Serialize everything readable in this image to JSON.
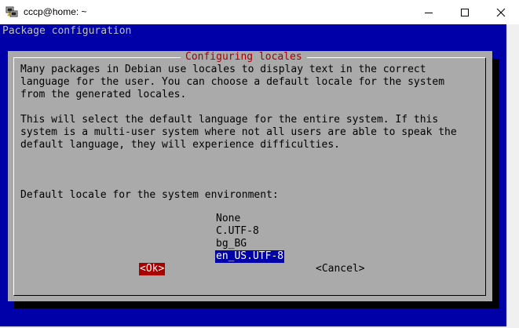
{
  "window": {
    "title": "cccp@home: ~"
  },
  "terminal": {
    "header": "Package configuration"
  },
  "dialog": {
    "title": "Configuring locales",
    "paragraph1": "Many packages in Debian use locales to display text in the correct\nlanguage for the user. You can choose a default locale for the system\nfrom the generated locales.",
    "paragraph2": "This will select the default language for the entire system. If this\nsystem is a multi-user system where not all users are able to speak the\ndefault language, they will experience difficulties.",
    "prompt": "Default locale for the system environment:",
    "options": [
      {
        "label": "None"
      },
      {
        "label": "C.UTF-8"
      },
      {
        "label": "bg_BG"
      },
      {
        "label": "en_US.UTF-8"
      }
    ],
    "selected_index": 3,
    "ok_label": "<Ok>",
    "cancel_label": "<Cancel>"
  },
  "colors": {
    "terminal_bg": "#0000a8",
    "dialog_bg": "#aaaaaa",
    "title_red": "#a80000",
    "highlight_blue": "#0000a8",
    "ok_bg": "#a80000"
  },
  "icons": {
    "app": "putty-icon",
    "minimize": "minimize-icon",
    "maximize": "maximize-icon",
    "close": "close-icon"
  }
}
